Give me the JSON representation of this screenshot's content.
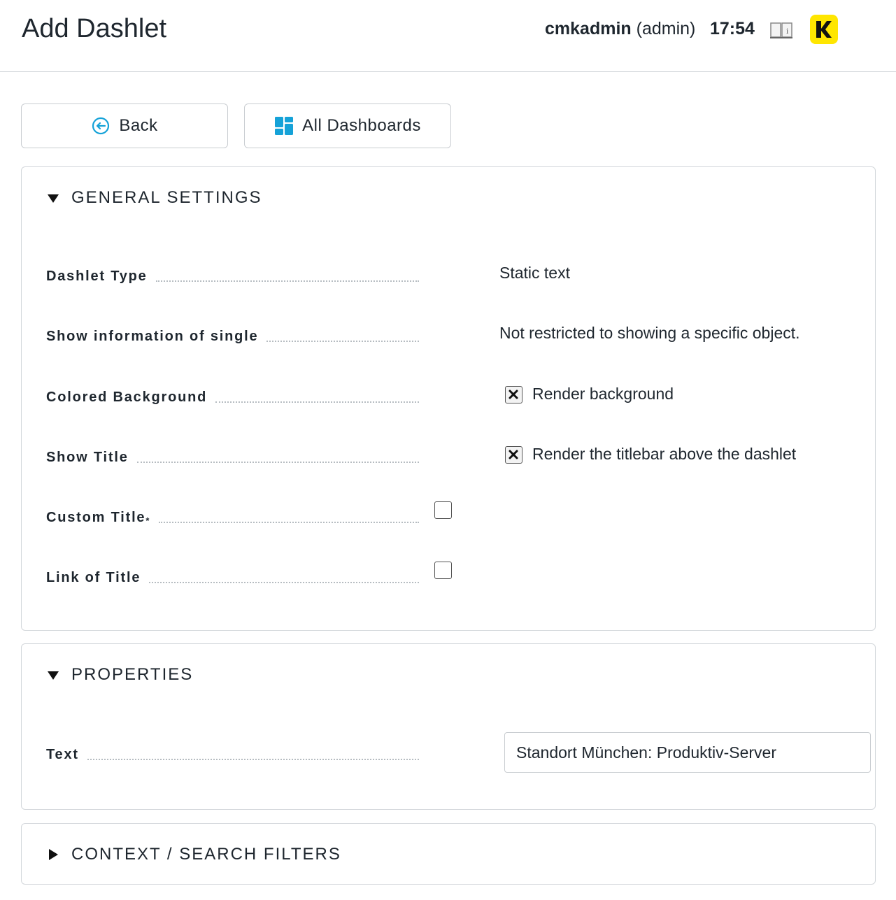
{
  "header": {
    "title": "Add Dashlet",
    "user_name": "cmkadmin",
    "user_role": "(admin)",
    "time": "17:54"
  },
  "toolbar": {
    "back_label": "Back",
    "dashboards_label": "All Dashboards"
  },
  "general": {
    "heading": "GENERAL SETTINGS",
    "dashlet_type_label": "Dashlet Type",
    "dashlet_type_value": "Static text",
    "single_label": "Show information of single",
    "single_value": "Not restricted to showing a specific object.",
    "colored_bg_label": "Colored Background",
    "colored_bg_checkbox": "Render background",
    "show_title_label": "Show Title",
    "show_title_checkbox": "Render the titlebar above the dashlet",
    "custom_title_label": "Custom Title",
    "custom_title_marker": "*",
    "link_title_label": "Link of Title"
  },
  "properties": {
    "heading": "PROPERTIES",
    "text_label": "Text",
    "text_value": "Standort München: Produktiv-Server"
  },
  "context": {
    "heading": "CONTEXT / SEARCH FILTERS"
  },
  "icons": [
    "arrow-left-circle-icon",
    "dashboards-icon",
    "book-icon",
    "checkmk-logo",
    "triangle-down-icon",
    "triangle-right-icon"
  ],
  "colors": {
    "accent": "#15a2d8",
    "logo_yellow": "#ffe600",
    "border": "#d3d7db"
  }
}
